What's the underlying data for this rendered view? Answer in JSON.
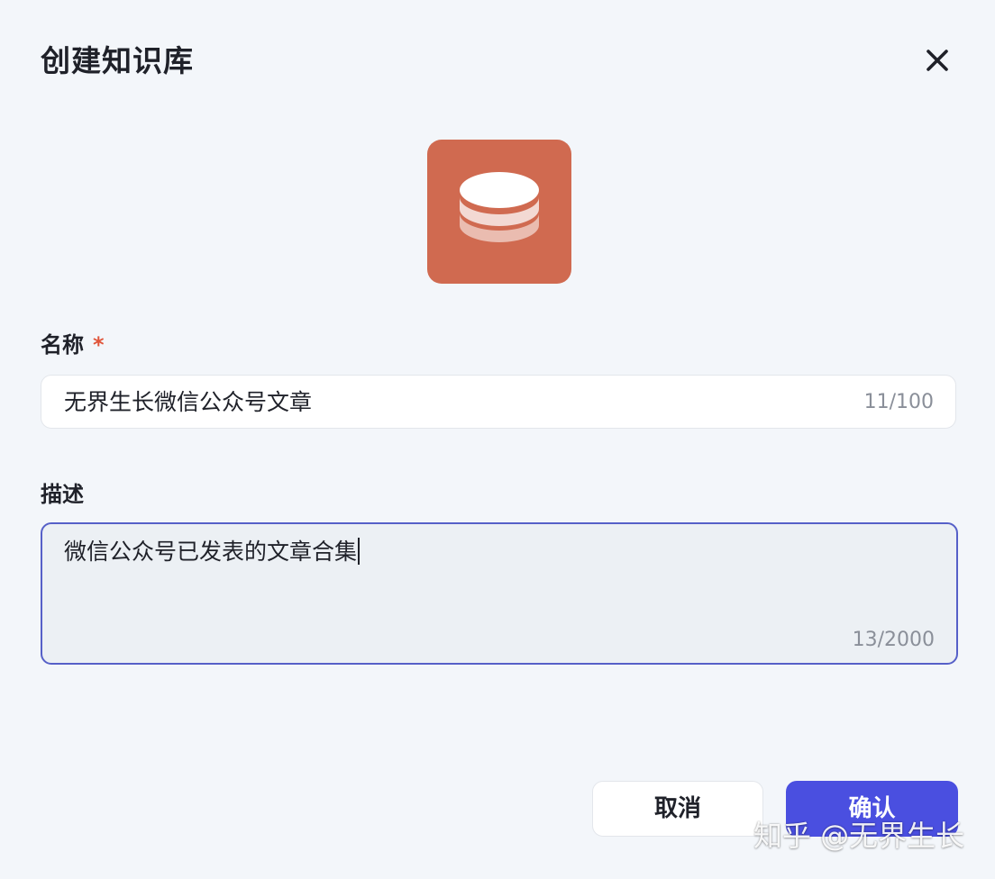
{
  "dialog": {
    "title": "创建知识库",
    "close_icon": "close-icon",
    "knowledge_base_icon": "database-stack-icon",
    "icon_color": "#d06a50"
  },
  "name_field": {
    "label": "名称",
    "required_mark": "*",
    "value": "无界生长微信公众号文章",
    "counter": "11/100"
  },
  "description_field": {
    "label": "描述",
    "value": "微信公众号已发表的文章合集",
    "counter": "13/2000"
  },
  "footer": {
    "cancel_label": "取消",
    "confirm_label": "确认",
    "confirm_color": "#4a4fe0"
  },
  "watermark": "知乎 @无界生长"
}
